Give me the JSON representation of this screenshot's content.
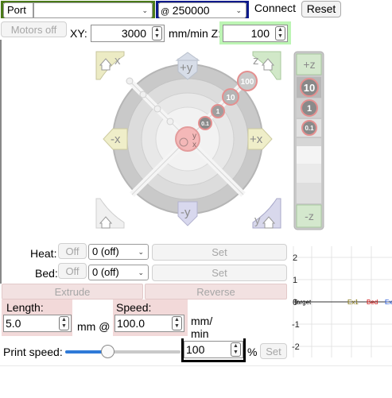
{
  "toolbar": {
    "port_label": "Port",
    "port_value": "",
    "baud_prefix": "@",
    "baud_value": "250000",
    "connect_label": "Connect",
    "reset_label": "Reset"
  },
  "motion": {
    "motors_off_label": "Motors off",
    "xy_label": "XY:",
    "xy_value": "3000",
    "units_label": "mm/min Z:",
    "z_value": "100"
  },
  "jog": {
    "home_x": "x",
    "home_z": "z",
    "home_all": "",
    "home_y": "y",
    "plus_y": "+y",
    "minus_y": "-y",
    "minus_x": "-x",
    "plus_x": "+x",
    "step_100": "100",
    "step_10": "10",
    "step_1": "1",
    "step_01": "0.1",
    "center_y": "y",
    "center_x": "x",
    "plus_z": "+z",
    "minus_z": "-z",
    "z_10": "10",
    "z_1": "1",
    "z_01": "0.1"
  },
  "temps": {
    "heat_label": "Heat:",
    "heat_off": "Off",
    "heat_select": "0 (off)",
    "heat_set": "Set",
    "bed_label": "Bed:",
    "bed_off": "Off",
    "bed_select": "0 (off)",
    "bed_set": "Set"
  },
  "extrude": {
    "extrude_label": "Extrude",
    "reverse_label": "Reverse",
    "length_label": "Length:",
    "length_value": "5.0",
    "mm_at": "mm @",
    "speed_label": "Speed:",
    "speed_value": "100.0",
    "speed_units": "mm/\nmin"
  },
  "print_speed": {
    "label": "Print speed:",
    "slider_fraction": 0.35,
    "value": "100",
    "percent": "%",
    "set_label": "Set"
  },
  "graph": {
    "y_ticks": [
      "2",
      "1",
      "0",
      "-1",
      "-2"
    ],
    "legend": [
      {
        "name": "Target",
        "color": "#000000"
      },
      {
        "name": "Ex1",
        "color": "#7a6a00"
      },
      {
        "name": "Bed",
        "color": "#cc0000"
      },
      {
        "name": "Ex",
        "color": "#1a4fd6"
      }
    ]
  }
}
